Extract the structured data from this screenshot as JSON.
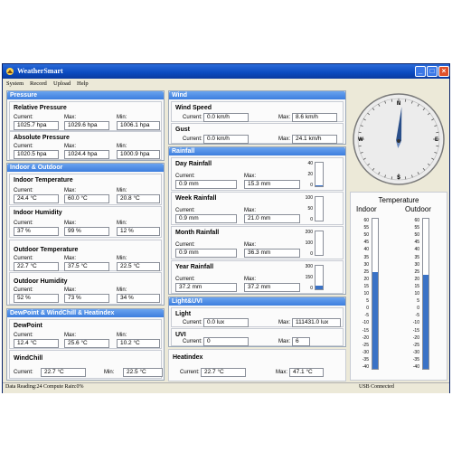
{
  "window": {
    "title": "WeatherSmart"
  },
  "menu": [
    "System",
    "Record",
    "Upload",
    "Help"
  ],
  "labels": {
    "current": "Current:",
    "max": "Max:",
    "min": "Min:"
  },
  "pressure": {
    "header": "Pressure",
    "relative": {
      "title": "Relative Pressure",
      "current": "1025.7 hpa",
      "max": "1029.6 hpa",
      "min": "1006.1 hpa"
    },
    "absolute": {
      "title": "Absolute Pressure",
      "current": "1020.5 hpa",
      "max": "1024.4 hpa",
      "min": "1000.9 hpa"
    }
  },
  "indoor_outdoor": {
    "header": "Indoor & Outdoor",
    "indoor_temp": {
      "title": "Indoor Temperature",
      "current": "24.4 °C",
      "max": "60.0 °C",
      "min": "20.8 °C"
    },
    "indoor_humidity": {
      "title": "Indoor Humidity",
      "current": "37 %",
      "max": "99 %",
      "min": "12 %"
    },
    "outdoor_temp": {
      "title": "Outdoor Temperature",
      "current": "22.7 °C",
      "max": "37.5 °C",
      "min": "22.5 °C"
    },
    "outdoor_humidity": {
      "title": "Outdoor Humidity",
      "current": "52 %",
      "max": "73 %",
      "min": "34 %"
    }
  },
  "dewpoint_windchill": {
    "header": "DewPoint & WindChill & Heatindex",
    "dewpoint": {
      "title": "DewPoint",
      "current": "12.4 °C",
      "max": "25.6 °C",
      "min": "10.2 °C"
    },
    "windchill": {
      "title": "WindChill",
      "current": "22.7 °C",
      "min": "22.5 °C"
    }
  },
  "wind": {
    "header": "Wind",
    "speed": {
      "title": "Wind Speed",
      "current": "0.0 km/h",
      "max": "8.6 km/h"
    },
    "gust": {
      "title": "Gust",
      "current": "0.0 km/h",
      "max": "24.1 km/h"
    }
  },
  "rainfall": {
    "header": "Rainfall",
    "day": {
      "title": "Day Rainfall",
      "current": "0.9 mm",
      "max": "15.3 mm",
      "scale": [
        "40",
        "20",
        "0"
      ]
    },
    "week": {
      "title": "Week Rainfall",
      "current": "0.9 mm",
      "max": "21.0 mm",
      "scale": [
        "100",
        "50",
        "0"
      ]
    },
    "month": {
      "title": "Month Rainfall",
      "current": "0.9 mm",
      "max": "36.3 mm",
      "scale": [
        "200",
        "100",
        "0"
      ]
    },
    "year": {
      "title": "Year Rainfall",
      "current": "37.2 mm",
      "max": "37.2 mm",
      "scale": [
        "300",
        "150",
        "0"
      ]
    }
  },
  "light_uvi": {
    "header": "Light&UVI",
    "light": {
      "title": "Light",
      "current": "0.0 lux",
      "max": "111431.0 lux"
    },
    "uvi": {
      "title": "UVI",
      "current": "0",
      "max": "6"
    }
  },
  "heatindex": {
    "title": "Heatindex",
    "current": "22.7 °C",
    "max": "47.1 °C"
  },
  "compass": {
    "n": "N",
    "s": "S",
    "e": "E",
    "w": "W",
    "needle_bearing_deg": 5
  },
  "thermometer": {
    "title": "Temperature",
    "indoor_label": "Indoor",
    "outdoor_label": "Outdoor",
    "scale": [
      "60",
      "55",
      "50",
      "45",
      "40",
      "35",
      "30",
      "25",
      "20",
      "15",
      "10",
      "5",
      "0",
      "-5",
      "-10",
      "-15",
      "-20",
      "-25",
      "-30",
      "-35",
      "-40"
    ],
    "indoor_value_c": 24.4,
    "outdoor_value_c": 22.7,
    "range_c": [
      -40,
      60
    ]
  },
  "status": {
    "left": "Data Reading:24 Compute Rain:0%",
    "right": "USB Connected"
  },
  "colors": {
    "titlebar": "#0a4ac0",
    "panel_header": "#3d7ede",
    "fill": "#3a72c6"
  }
}
